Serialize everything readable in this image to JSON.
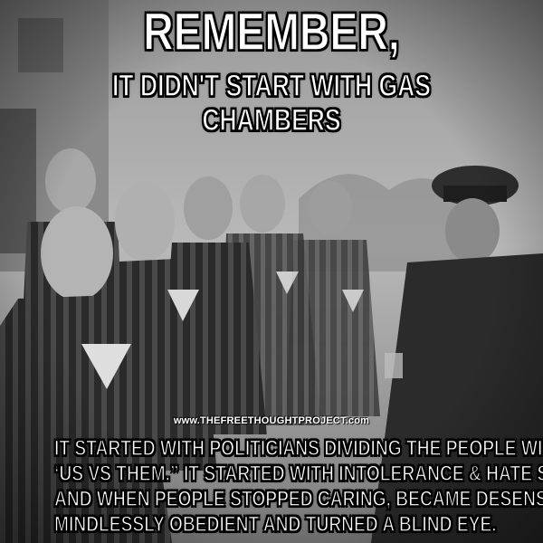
{
  "headline": {
    "line1": "REMEMBER,",
    "line2": "IT DIDN'T START WITH GAS CHAMBERS"
  },
  "photo": {
    "subject": "prisoners in striped uniforms with triangle badges standing in rows, guard in peaked cap at right",
    "tone": "black-and-white"
  },
  "watermark": "www.THEFREETHOUGHTPROJECT.com",
  "body": {
    "lines": [
      "IT STARTED WITH POLITICIANS DIVIDING THE PEOPLE WITH",
      "‘US VS THEM.” IT STARTED WITH INTOLERANCE & HATE SPEECH",
      "AND WHEN PEOPLE STOPPED CARING, BECAME DESENSITIZED",
      "MINDLESSLY OBEDIENT AND TURNED A BLIND EYE."
    ]
  }
}
